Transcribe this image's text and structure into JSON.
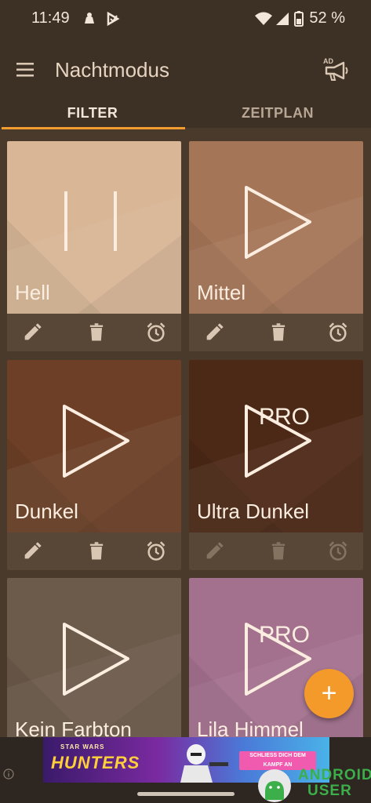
{
  "status": {
    "time": "11:49",
    "battery": "52 %"
  },
  "appbar": {
    "title": "Nachtmodus",
    "ad_icon": "ad-megaphone-icon",
    "ad_label": "AD"
  },
  "tabs": [
    {
      "label": "FILTER",
      "active": true
    },
    {
      "label": "ZEITPLAN",
      "active": false
    }
  ],
  "filters": [
    {
      "name": "Hell",
      "state": "pause",
      "pro": false,
      "color": "#d8b696"
    },
    {
      "name": "Mittel",
      "state": "play",
      "pro": false,
      "color": "#a57558"
    },
    {
      "name": "Dunkel",
      "state": "play",
      "pro": false,
      "color": "#6c3f26"
    },
    {
      "name": "Ultra Dunkel",
      "state": "play",
      "pro": true,
      "pro_label": "PRO",
      "color": "#4c2816"
    },
    {
      "name": "Kein Farbton",
      "state": "play",
      "pro": false,
      "color": "#6c5a4a"
    },
    {
      "name": "Lila Himmel",
      "state": "play",
      "pro": true,
      "pro_label": "PRO",
      "color": "#a3708e"
    }
  ],
  "card_actions": [
    "edit-icon",
    "trash-icon",
    "alarm-icon"
  ],
  "fab": {
    "label": "+"
  },
  "ad": {
    "line1": "STAR WARS",
    "line2": "HUNTERS",
    "cta": "SCHLIESS DICH DEM KAMPF AN"
  },
  "watermark": {
    "line1": "ANDROID",
    "line2": "USER"
  },
  "colors": {
    "accent": "#f39a2a",
    "appbar": "#3d3024",
    "background": "#4a3a2c"
  }
}
